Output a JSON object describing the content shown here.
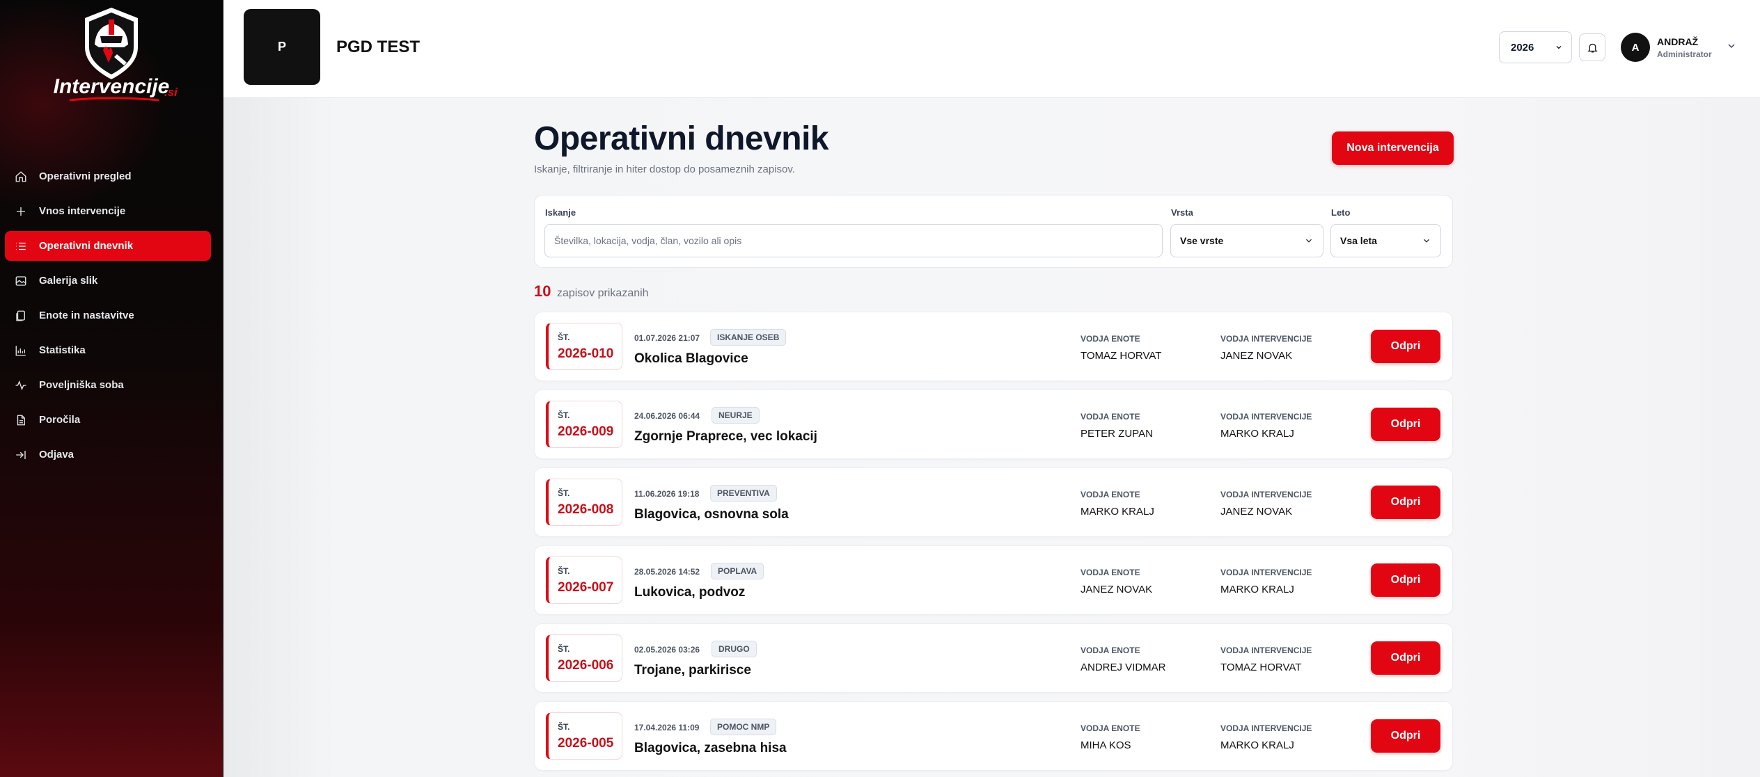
{
  "brand": {
    "logo_text": "Intervencije",
    "logo_suffix": ".si",
    "accent": "#e20613"
  },
  "sidebar": {
    "items": [
      {
        "label": "Operativni pregled",
        "icon": "home-icon"
      },
      {
        "label": "Vnos intervencije",
        "icon": "plus-icon"
      },
      {
        "label": "Operativni dnevnik",
        "icon": "list-icon",
        "active": true
      },
      {
        "label": "Galerija slik",
        "icon": "image-icon"
      },
      {
        "label": "Enote in nastavitve",
        "icon": "copy-icon"
      },
      {
        "label": "Statistika",
        "icon": "chart-icon"
      },
      {
        "label": "Poveljniška soba",
        "icon": "activity-icon"
      },
      {
        "label": "Poročila",
        "icon": "document-icon"
      },
      {
        "label": "Odjava",
        "icon": "logout-icon"
      }
    ]
  },
  "header": {
    "org_initial": "P",
    "org_name": "PGD TEST",
    "year": "2026",
    "user_initial": "A",
    "user_name": "ANDRAŽ",
    "user_role": "Administrator"
  },
  "page": {
    "title": "Operativni dnevnik",
    "subtitle": "Iskanje, filtriranje in hiter dostop do posameznih zapisov.",
    "new_button": "Nova intervencija"
  },
  "filters": {
    "search_label": "Iskanje",
    "search_placeholder": "Številka, lokacija, vodja, član, vozilo ali opis",
    "type_label": "Vrsta",
    "type_value": "Vse vrste",
    "year_label": "Leto",
    "year_value": "Vsa leta"
  },
  "results": {
    "count": "10",
    "count_text": "zapisov prikazanih"
  },
  "labels": {
    "num_prefix": "ŠT.",
    "unit_leader": "VODJA ENOTE",
    "intervention_leader": "VODJA INTERVENCIJE",
    "open_button": "Odpri"
  },
  "records": [
    {
      "number": "2026-010",
      "datetime": "01.07.2026 21:07",
      "type": "ISKANJE OSEB",
      "location": "Okolica Blagovice",
      "unit_leader": "TOMAZ HORVAT",
      "intervention_leader": "JANEZ NOVAK"
    },
    {
      "number": "2026-009",
      "datetime": "24.06.2026 06:44",
      "type": "NEURJE",
      "location": "Zgornje Praprece, vec lokacij",
      "unit_leader": "PETER ZUPAN",
      "intervention_leader": "MARKO KRALJ"
    },
    {
      "number": "2026-008",
      "datetime": "11.06.2026 19:18",
      "type": "PREVENTIVA",
      "location": "Blagovica, osnovna sola",
      "unit_leader": "MARKO KRALJ",
      "intervention_leader": "JANEZ NOVAK"
    },
    {
      "number": "2026-007",
      "datetime": "28.05.2026 14:52",
      "type": "POPLAVA",
      "location": "Lukovica, podvoz",
      "unit_leader": "JANEZ NOVAK",
      "intervention_leader": "MARKO KRALJ"
    },
    {
      "number": "2026-006",
      "datetime": "02.05.2026 03:26",
      "type": "DRUGO",
      "location": "Trojane, parkirisce",
      "unit_leader": "ANDREJ VIDMAR",
      "intervention_leader": "TOMAZ HORVAT"
    },
    {
      "number": "2026-005",
      "datetime": "17.04.2026 11:09",
      "type": "POMOC NMP",
      "location": "Blagovica, zasebna hisa",
      "unit_leader": "MIHA KOS",
      "intervention_leader": "MARKO KRALJ"
    }
  ]
}
